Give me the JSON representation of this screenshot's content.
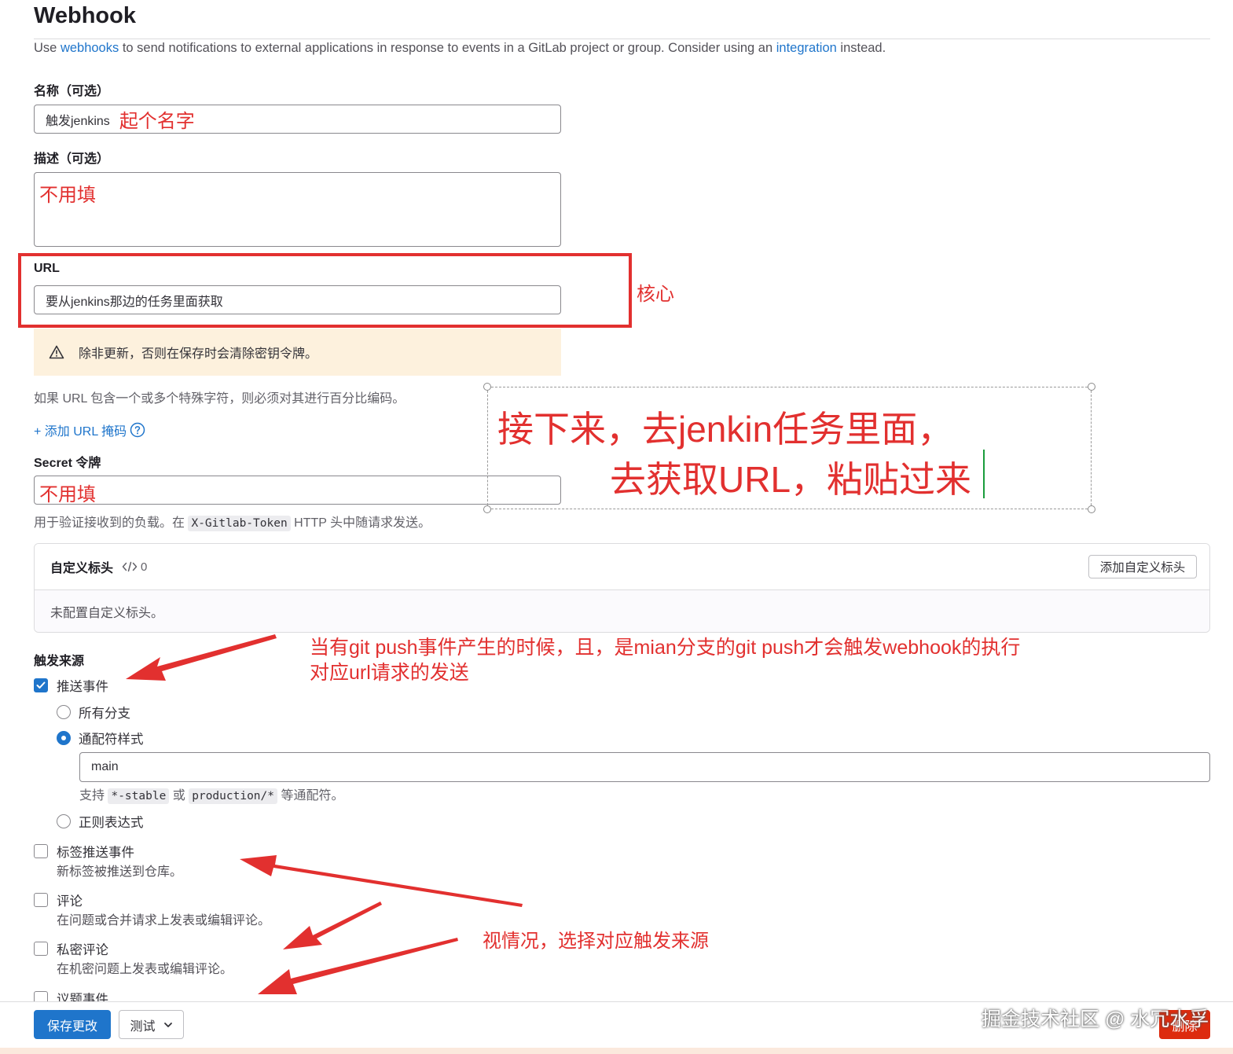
{
  "page": {
    "title": "Webhook",
    "intro": {
      "prefix": "Use ",
      "link1": "webhooks",
      "middle": " to send notifications to external applications in response to events in a GitLab project or group. Consider using an ",
      "link2": "integration",
      "suffix": " instead."
    }
  },
  "name_field": {
    "label": "名称（可选）",
    "value": "触发jenkins",
    "annotation": "起个名字"
  },
  "description_field": {
    "label": "描述（可选）",
    "annotation": "不用填"
  },
  "url_field": {
    "label": "URL",
    "value": "要从jenkins那边的任务里面获取",
    "annotation": "核心",
    "warning": "除非更新，否则在保存时会清除密钥令牌。",
    "help": "如果 URL 包含一个或多个特殊字符，则必须对其进行百分比编码。",
    "add_mask": "+ 添加 URL 掩码"
  },
  "secret_field": {
    "label": "Secret 令牌",
    "annotation": "不用填",
    "help_prefix": "用于验证接收到的负载。在",
    "help_code": "X-Gitlab-Token",
    "help_suffix": "HTTP 头中随请求发送。"
  },
  "custom_headers": {
    "title": "自定义标头",
    "count": "0",
    "add_button": "添加自定义标头",
    "empty": "未配置自定义标头。"
  },
  "triggers": {
    "label": "触发来源",
    "push_events": {
      "label": "推送事件",
      "checked": true
    },
    "branch_options": {
      "all": "所有分支",
      "wildcard": "通配符样式",
      "regex": "正则表达式",
      "selected": "wildcard"
    },
    "wildcard_value": "main",
    "wildcard_help": {
      "prefix": "支持",
      "code1": "*-stable",
      "or": "或",
      "code2": "production/*",
      "suffix": "等通配符。"
    },
    "tag_push": {
      "label": "标签推送事件",
      "desc": "新标签被推送到仓库。"
    },
    "comments": {
      "label": "评论",
      "desc": "在问题或合并请求上发表或编辑评论。"
    },
    "confidential_comments": {
      "label": "私密评论",
      "desc": "在机密问题上发表或编辑评论。"
    },
    "issues": {
      "label": "议题事件"
    }
  },
  "footer": {
    "save_button": "保存更改",
    "test_button": "测试",
    "delete_button": "删除",
    "watermark": "掘金技术社区 @ 水冗水孚"
  },
  "annotations": {
    "big_note_line1": "接下来，去jenkin任务里面，",
    "big_note_line2": "去获取URL，粘贴过来",
    "push_note_line1": "当有git push事件产生的时候，且，是mian分支的git push才会触发webhook的执行",
    "push_note_line2": "对应url请求的发送",
    "source_note": "视情况，选择对应触发来源"
  },
  "colors": {
    "accent": "#1f75cb",
    "annotation": "#e2302f",
    "danger": "#dd2b0e",
    "warning_bg": "#fdf1dd"
  },
  "icons": [
    "warning-icon",
    "help-icon",
    "code-icon",
    "chevron-down-icon",
    "check-icon"
  ]
}
